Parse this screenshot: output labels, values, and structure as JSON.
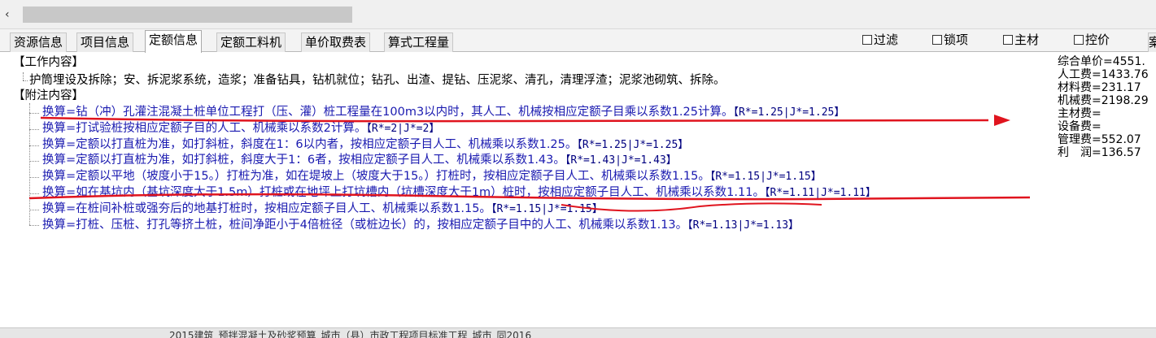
{
  "scrollbar": {
    "left_arrow_icon": "chevron-left-icon"
  },
  "tabs": [
    {
      "label": "资源信息",
      "active": false
    },
    {
      "label": "项目信息",
      "active": false
    },
    {
      "label": "定额信息",
      "active": true
    },
    {
      "label": "定额工料机",
      "active": false
    },
    {
      "label": "单价取费表",
      "active": false
    },
    {
      "label": "算式工程量",
      "active": false
    }
  ],
  "filters": {
    "filter": "过滤",
    "lock": "锁项",
    "main_material": "主材",
    "control_price": "控价"
  },
  "tab_right_label": "案",
  "tree": {
    "work_header": "【工作内容】",
    "work_content": "护筒埋设及拆除；安、拆泥浆系统，造浆；准备钻具，钻机就位；钻孔、出渣、提钻、压泥浆、清孔，清理浮渣；泥浆池砌筑、拆除。",
    "notes_header": "【附注内容】",
    "items": [
      {
        "text": "换算=钻（冲）孔灌注混凝土桩单位工程打（压、灌）桩工程量在100m3以内时，其人工、机械按相应定额子目乘以系数1.25计算。",
        "coef": "【R*=1.25|J*=1.25】"
      },
      {
        "text": "换算=打试验桩按相应定额子目的人工、机械乘以系数2计算。",
        "coef": "【R*=2|J*=2】"
      },
      {
        "text": "换算=定额以打直桩为准，如打斜桩，斜度在1：6以内者，按相应定额子目人工、机械乘以系数1.25。",
        "coef": "【R*=1.25|J*=1.25】"
      },
      {
        "text": "换算=定额以打直桩为准，如打斜桩，斜度大于1：6者，按相应定额子目人工、机械乘以系数1.43。",
        "coef": "【R*=1.43|J*=1.43】"
      },
      {
        "text": "换算=定额以平地（坡度小于15。）打桩为准，如在堤坡上（坡度大于15。）打桩时，按相应定额子目人工、机械乘以系数1.15。",
        "coef": "【R*=1.15|J*=1.15】"
      },
      {
        "text": "换算=如在基坑内（基坑深度大于1.5m）打桩或在地坪上打坑槽内（坑槽深度大于1m）桩时，按相应定额子目人工、机械乘以系数1.11。",
        "coef": "【R*=1.11|J*=1.11】"
      },
      {
        "text": "换算=在桩间补桩或强夯后的地基打桩时，按相应定额子目人工、机械乘以系数1.15。",
        "coef": "【R*=1.15|J*=1.15】"
      },
      {
        "text": "换算=打桩、压桩、打孔等挤土桩，桩间净距小于4倍桩径（或桩边长）的，按相应定额子目中的人工、机械乘以系数1.13。",
        "coef": "【R*=1.13|J*=1.13】"
      }
    ]
  },
  "summary": {
    "unit_price": "综合单价=4551.",
    "labor": "人工费=1433.76",
    "material": "材料费=231.17",
    "machine": "机械费=2198.29",
    "main_material": "主材费=",
    "equipment": "设备费=",
    "management": "管理费=552.07",
    "profit": "利　润=136.57"
  },
  "status_text": "2015建筑_预拌混凝土及砂浆预算_城市（县）市政工程项目标准工程_城市_同2016",
  "colors": {
    "item_text": "#1a1ab0",
    "coef_text": "#000080",
    "annotation_red": "#e0141e",
    "active_tab": "#ffffff"
  }
}
